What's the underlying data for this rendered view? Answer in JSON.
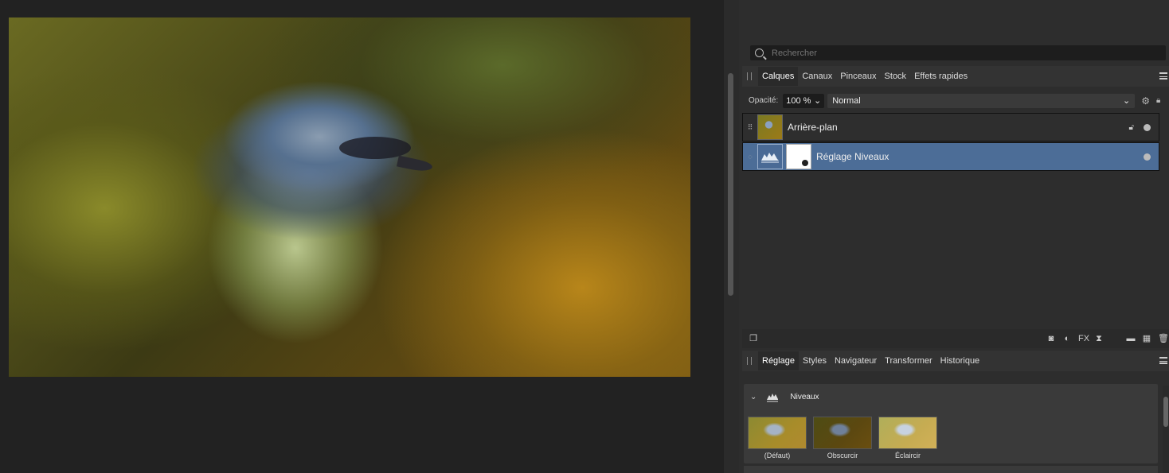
{
  "search": {
    "placeholder": "Rechercher"
  },
  "top_tabs": [
    {
      "label": "Calques",
      "active": true
    },
    {
      "label": "Canaux",
      "active": false
    },
    {
      "label": "Pinceaux",
      "active": false
    },
    {
      "label": "Stock",
      "active": false
    },
    {
      "label": "Effets rapides",
      "active": false
    }
  ],
  "layer_controls": {
    "opacity_label": "Opacité:",
    "opacity_value": "100 %",
    "blend_mode": "Normal"
  },
  "layers": [
    {
      "name": "Arrière-plan",
      "locked": true,
      "visible": true,
      "selected": false
    },
    {
      "name": "Réglage Niveaux",
      "locked": false,
      "visible": true,
      "selected": true
    }
  ],
  "layer_toolbar_icons": [
    "copy-icon",
    "mask-icon",
    "adjustment-icon",
    "fx-icon",
    "hourglass-icon",
    "folder-icon",
    "pixel-layer-icon",
    "trash-icon"
  ],
  "fx_label": "FX",
  "bottom_tabs": [
    {
      "label": "Réglage",
      "active": true
    },
    {
      "label": "Styles",
      "active": false
    },
    {
      "label": "Navigateur",
      "active": false
    },
    {
      "label": "Transformer",
      "active": false
    },
    {
      "label": "Historique",
      "active": false
    }
  ],
  "adjustment": {
    "title": "Niveaux",
    "presets": [
      {
        "label": "(Défaut)"
      },
      {
        "label": "Obscurcir"
      },
      {
        "label": "Éclaircir"
      }
    ]
  },
  "colors": {
    "selected_layer": "#4c6d97",
    "panel_bg": "#2d2d2d",
    "canvas_bg": "#222222"
  }
}
